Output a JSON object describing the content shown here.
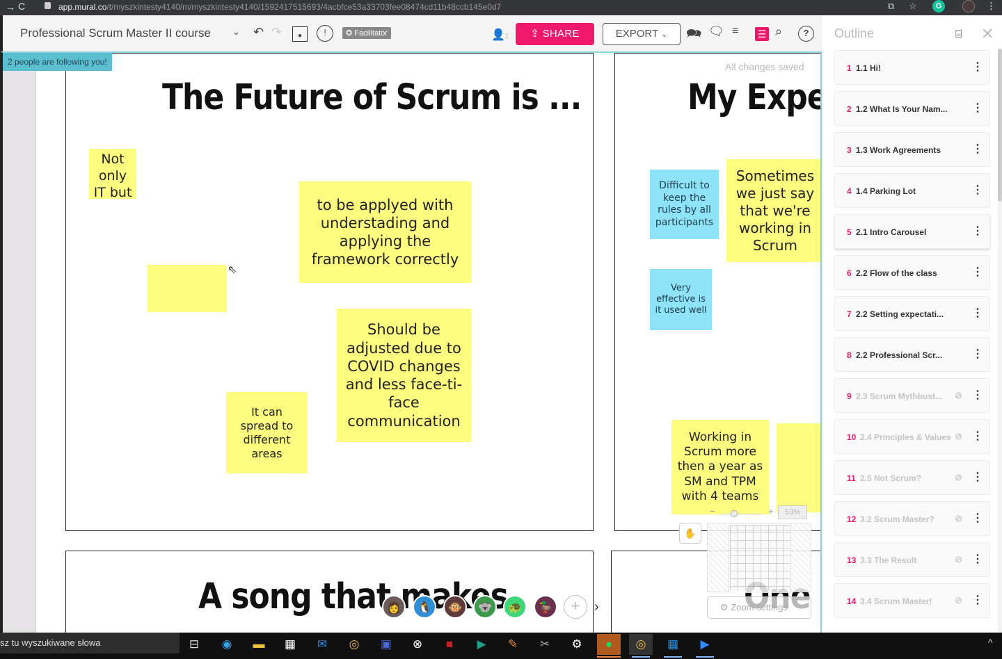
{
  "browser": {
    "url_host": "app.mural.co",
    "url_path": "/t/myszkintesty4140/m/myszkintesty4140/1592417515693/4acbfce53a33703fee08474cd11b48ccb145e0d7"
  },
  "toolbar": {
    "board_title": "Professional Scrum Master II course",
    "facilitator_label": "Facilitator",
    "user_count": "1",
    "share_label": "SHARE",
    "export_label": "EXPORT"
  },
  "canvas": {
    "following_banner": "2 people are following you!",
    "save_status": "All changes saved",
    "frames": [
      {
        "title": "The Future of Scrum is ...",
        "stickies": [
          {
            "text": "Not only IT but",
            "color": "yellow"
          },
          {
            "text": "to be applyed with understading and applying the framework correctly",
            "color": "yellow"
          },
          {
            "text": "",
            "color": "yellow"
          },
          {
            "text": "Should be adjusted due to COVID changes and less face-ti-face communication",
            "color": "yellow"
          },
          {
            "text": "It can spread to different areas",
            "color": "yellow"
          }
        ]
      },
      {
        "title": "My Exper",
        "stickies": [
          {
            "text": "Difficult to keep the rules by all participants",
            "color": "blue"
          },
          {
            "text": "Sometimes we just say that we're working in Scrum",
            "color": "yellow"
          },
          {
            "text": "Very effective is it used well",
            "color": "blue"
          },
          {
            "text": "Working in Scrum more then a year as SM and TPM with 4 teams",
            "color": "yellow"
          },
          {
            "text": "",
            "color": "yellow"
          }
        ]
      },
      {
        "title": "A song that makes"
      },
      {
        "title": "One t"
      }
    ],
    "zoom_percent": "53%",
    "zoom_settings_label": "Zoom settings",
    "collaborators": [
      "user-photo",
      "penguin",
      "monkey",
      "koala",
      "turtle",
      "platypus"
    ]
  },
  "outline": {
    "title": "Outline",
    "items": [
      {
        "num": "1",
        "label": "1.1 Hi!",
        "hidden": false
      },
      {
        "num": "2",
        "label": "1.2 What Is Your Nam...",
        "hidden": false
      },
      {
        "num": "3",
        "label": "1.3 Work Agreements",
        "hidden": false
      },
      {
        "num": "4",
        "label": "1.4 Parking Lot",
        "hidden": false
      },
      {
        "num": "5",
        "label": "2.1 Intro Carousel",
        "hidden": false,
        "active": true
      },
      {
        "num": "6",
        "label": "2.2 Flow of the class",
        "hidden": false
      },
      {
        "num": "7",
        "label": "2.2 Setting expectati...",
        "hidden": false
      },
      {
        "num": "8",
        "label": "2.2 Professional Scr...",
        "hidden": false
      },
      {
        "num": "9",
        "label": "2.3 Scrum Mythbust...",
        "hidden": true
      },
      {
        "num": "10",
        "label": "2.4 Principles & Values",
        "hidden": true
      },
      {
        "num": "11",
        "label": "2.5 Not Scrum?",
        "hidden": true
      },
      {
        "num": "12",
        "label": "3.2 Scrum Master?",
        "hidden": true
      },
      {
        "num": "13",
        "label": "3.3 The Result",
        "hidden": true
      },
      {
        "num": "14",
        "label": "3.4 Scrum Master!",
        "hidden": true
      }
    ]
  },
  "taskbar": {
    "search_placeholder": "sz tu wyszukiwane słowa"
  },
  "colors": {
    "accent": "#f0186d",
    "sticky_yellow": "#fdfd80",
    "sticky_blue": "#8fe3f8",
    "following_banner": "#5bbfd0"
  }
}
